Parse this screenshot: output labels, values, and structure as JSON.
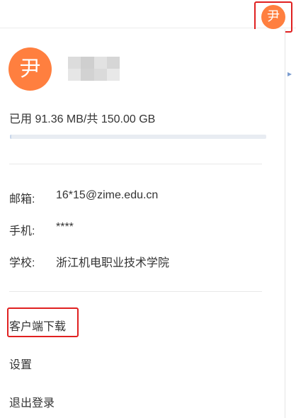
{
  "header": {
    "avatar_char": "尹"
  },
  "profile": {
    "avatar_char": "尹",
    "storage_text": "已用 91.36 MB/共 150.00 GB",
    "storage_used_fraction": 0.0006
  },
  "info": {
    "email_label": "邮箱:",
    "email_value": "16*15@zime.edu.cn",
    "phone_label": "手机:",
    "phone_value": "****",
    "school_label": "学校:",
    "school_value": "浙江机电职业技术学院"
  },
  "menu": {
    "client_download": "客户端下载",
    "settings": "设置",
    "logout": "退出登录"
  },
  "colors": {
    "avatar_bg": "#ff7f3f",
    "highlight": "#e02020"
  },
  "icons": {
    "edge_arrow": "chevron-right-icon"
  }
}
